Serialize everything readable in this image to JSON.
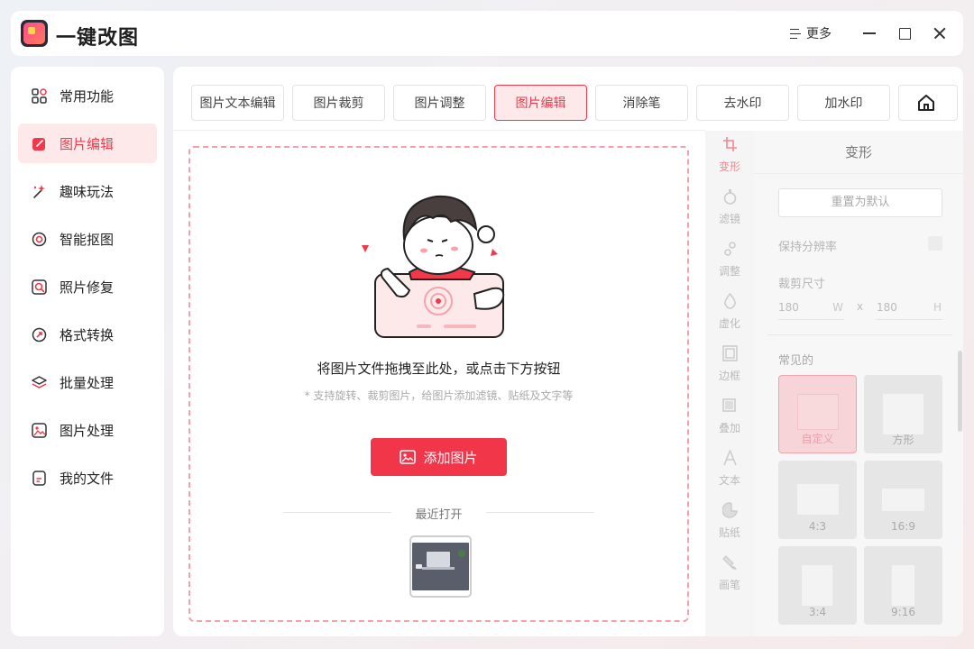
{
  "app": {
    "title": "一键改图",
    "more_label": "更多"
  },
  "sidebar": {
    "items": [
      {
        "label": "常用功能",
        "icon": "grid-icon"
      },
      {
        "label": "图片编辑",
        "icon": "edit-icon"
      },
      {
        "label": "趣味玩法",
        "icon": "magic-wand-icon"
      },
      {
        "label": "智能抠图",
        "icon": "target-icon"
      },
      {
        "label": "照片修复",
        "icon": "repair-icon"
      },
      {
        "label": "格式转换",
        "icon": "convert-icon"
      },
      {
        "label": "批量处理",
        "icon": "layers-icon"
      },
      {
        "label": "图片处理",
        "icon": "image-icon"
      },
      {
        "label": "我的文件",
        "icon": "file-icon"
      }
    ],
    "active_index": 1
  },
  "tabs": [
    {
      "label": "图片文本编辑"
    },
    {
      "label": "图片裁剪"
    },
    {
      "label": "图片调整"
    },
    {
      "label": "图片编辑"
    },
    {
      "label": "消除笔"
    },
    {
      "label": "去水印"
    },
    {
      "label": "加水印"
    }
  ],
  "active_tab": 3,
  "dropzone": {
    "instruction": "将图片文件拖拽至此处，或点击下方按钮",
    "hint": "* 支持旋转、裁剪图片，给图片添加滤镜、贴纸及文字等",
    "add_button": "添加图片",
    "recent_label": "最近打开"
  },
  "tools": [
    {
      "label": "变形",
      "icon": "crop-icon"
    },
    {
      "label": "滤镜",
      "icon": "filter-icon"
    },
    {
      "label": "调整",
      "icon": "adjust-icon"
    },
    {
      "label": "虚化",
      "icon": "blur-icon"
    },
    {
      "label": "边框",
      "icon": "frame-icon"
    },
    {
      "label": "叠加",
      "icon": "overlay-icon"
    },
    {
      "label": "文本",
      "icon": "text-icon"
    },
    {
      "label": "贴纸",
      "icon": "sticker-icon"
    },
    {
      "label": "画笔",
      "icon": "brush-icon"
    }
  ],
  "panel": {
    "title": "变形",
    "reset_button": "重置为默认",
    "keep_resolution": "保持分辨率",
    "crop_size_label": "裁剪尺寸",
    "width_value": "180",
    "width_unit": "W",
    "times": "x",
    "height_value": "180",
    "height_unit": "H",
    "common_label": "常见的",
    "ratios": [
      {
        "label": "自定义"
      },
      {
        "label": "方形"
      },
      {
        "label": "4:3"
      },
      {
        "label": "16:9"
      },
      {
        "label": "3:4"
      },
      {
        "label": "9:16"
      }
    ]
  },
  "colors": {
    "accent": "#f2364a",
    "active_bg": "#fde9ea"
  }
}
